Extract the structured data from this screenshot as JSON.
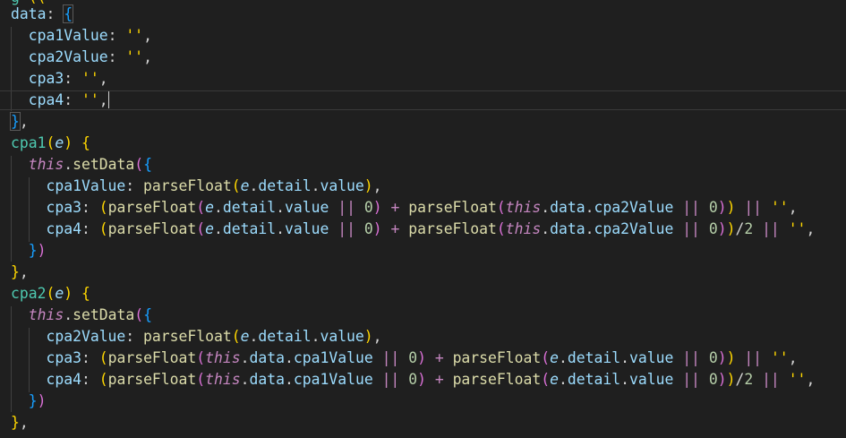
{
  "editor": {
    "language": "javascript",
    "theme_colors": {
      "background": "#1f1f1f",
      "property": "#9cdcfe",
      "function": "#4ec9b0",
      "call": "#dcdcaa",
      "keyword": "#c586c0",
      "string": "#ffd700",
      "number": "#b5cea8"
    },
    "tokens": {
      "data": "data",
      "cpa1Value": "cpa1Value",
      "cpa2Value": "cpa2Value",
      "cpa3": "cpa3",
      "cpa4": "cpa4",
      "cpa1": "cpa1",
      "cpa2": "cpa2",
      "e": "e",
      "this": "this",
      "setData": "setData",
      "parseFloat": "parseFloat",
      "detail": "detail",
      "value": "value",
      "data_prop": "data",
      "empty_str": "''",
      "zero": "0",
      "two": "2",
      "or": "||",
      "plus": "+"
    }
  }
}
